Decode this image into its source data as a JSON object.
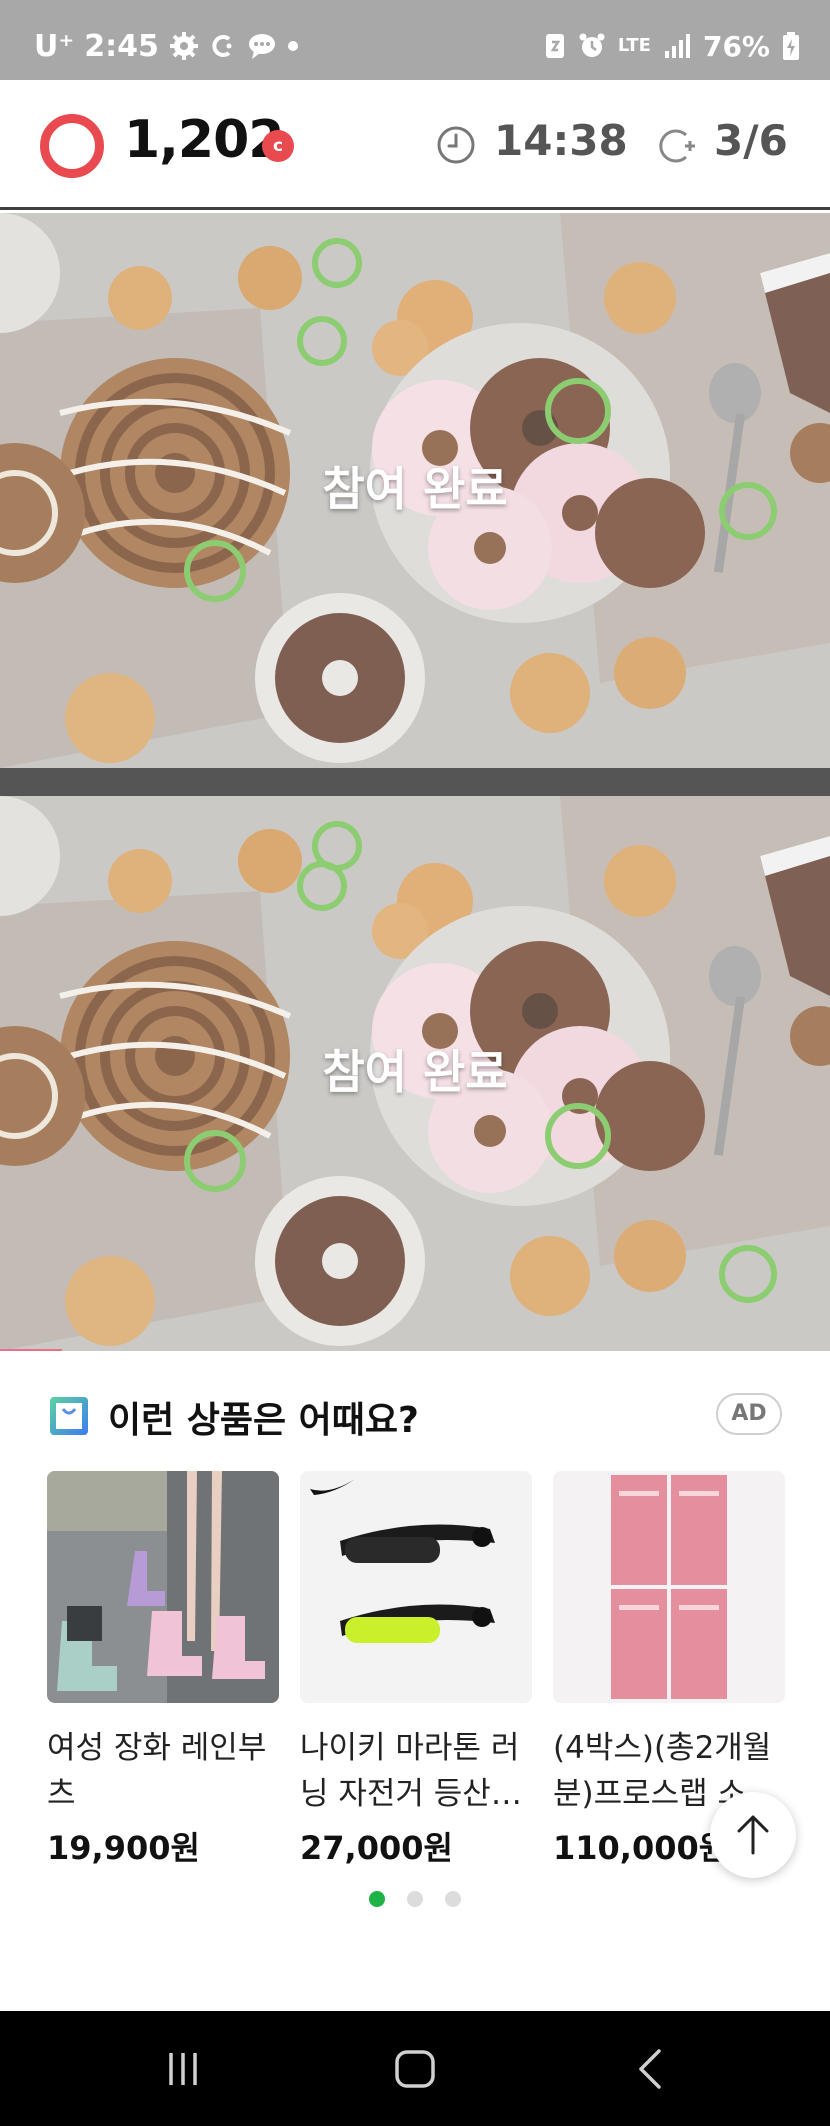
{
  "status_bar": {
    "carrier": "U⁺",
    "time": "2:45",
    "network": "LTE",
    "battery": "76%",
    "text_color": "#ffffff",
    "background": "#a8a8a8"
  },
  "game_header": {
    "score": "1,202",
    "coin_symbol": "c",
    "timer": "14:38",
    "progress": "3/6",
    "accent_color": "#e84a4f"
  },
  "panels": {
    "top_label": "참여 완료",
    "bottom_label": "참여 완료",
    "marker_color": "#6cbf4a"
  },
  "recommendations": {
    "title": "이런 상품은 어때요?",
    "ad_label": "AD",
    "products": [
      {
        "name": "여성 장화 레인부츠",
        "price": "19,900원"
      },
      {
        "name": "나이키 마라톤 러닝 자전거 등산…",
        "price": "27,000원"
      },
      {
        "name": "(4박스)(총2개월분)프로스랩 소…",
        "price": "110,000원"
      }
    ],
    "pagination_active_color": "#1db347"
  },
  "icons": {
    "top_button": "arrow-up-icon",
    "nav": [
      "recent-apps-icon",
      "home-icon",
      "back-icon"
    ]
  }
}
